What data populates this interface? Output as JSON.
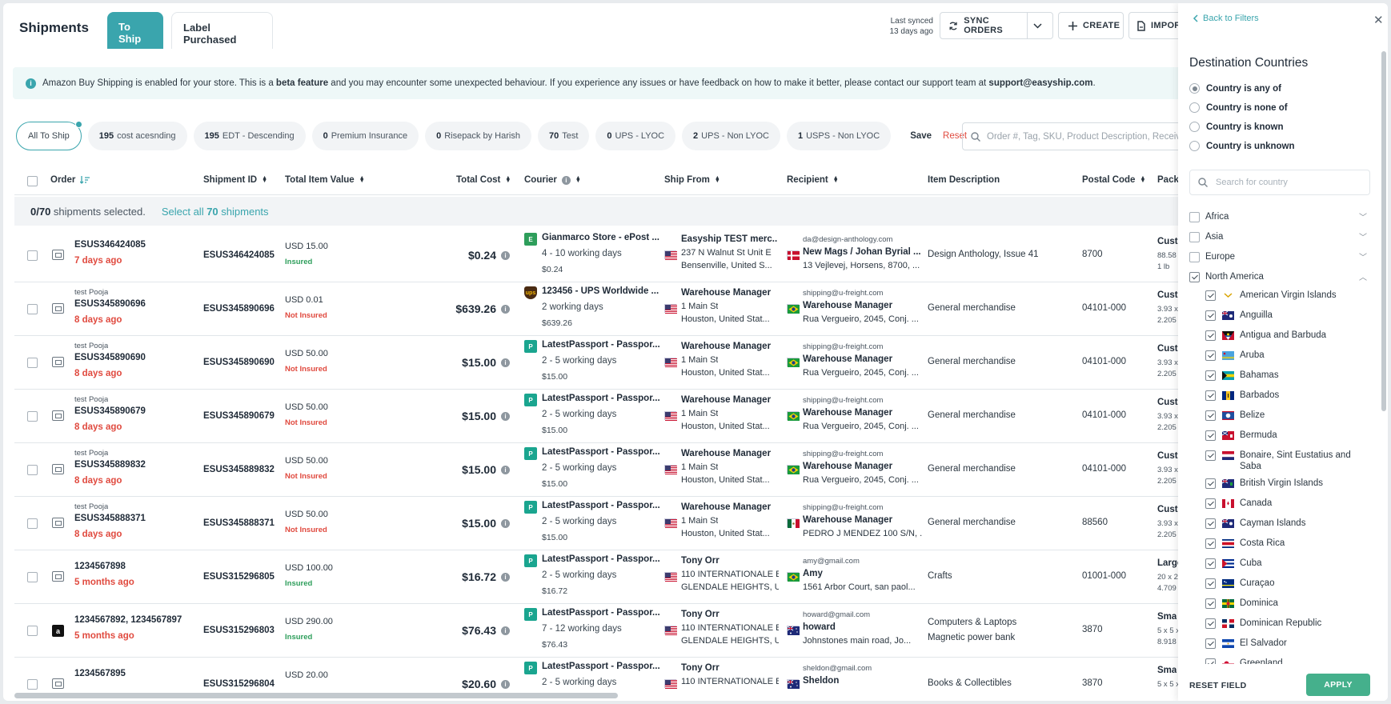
{
  "header": {
    "title": "Shipments",
    "tabs": [
      "To Ship",
      "Label Purchased"
    ],
    "last_synced_line1": "Last synced",
    "last_synced_line2": "13 days ago",
    "sync_label": "SYNC ORDERS",
    "create_label": "CREATE",
    "import_label": "IMPORT"
  },
  "banner": {
    "text_a": "Amazon Buy Shipping is enabled for your store. This is a ",
    "bold_a": "beta feature",
    "text_b": " and you may encounter some unexpected behaviour. If you experience any issues or have feedback on how to make it better, please contact our support team at ",
    "bold_b": "support@easyship.com",
    "text_c": "."
  },
  "chips": [
    {
      "count": "",
      "label": "All To Ship"
    },
    {
      "count": "195",
      "label": "cost acesnding"
    },
    {
      "count": "195",
      "label": "EDT - Descending"
    },
    {
      "count": "0",
      "label": "Premium Insurance"
    },
    {
      "count": "0",
      "label": "Risepack by Harish"
    },
    {
      "count": "70",
      "label": "Test"
    },
    {
      "count": "0",
      "label": "UPS - LYOC"
    },
    {
      "count": "2",
      "label": "UPS - Non LYOC"
    },
    {
      "count": "1",
      "label": "USPS - Non LYOC"
    }
  ],
  "chip_actions": {
    "save": "Save",
    "reset": "Reset"
  },
  "search": {
    "placeholder": "Order #, Tag, SKU, Product Description, Receiver"
  },
  "table": {
    "headers": [
      "Order",
      "Shipment ID",
      "Total Item Value",
      "Total Cost",
      "Courier",
      "Ship From",
      "Recipient",
      "Item Description",
      "Postal Code",
      "Pack"
    ],
    "selection": {
      "count": "0/70",
      "text": " shipments selected.",
      "select_all_a": "Select all ",
      "select_all_b": "70",
      "select_all_c": " shipments"
    },
    "rows": [
      {
        "tag": "",
        "order": "ESUS346424085",
        "ago": "7 days ago",
        "store": "store",
        "shipment_id": "ESUS346424085",
        "value": "USD 15.00",
        "insured": "Insured",
        "insured_color": "#2e9e5b",
        "cost": "$0.24",
        "courier_name": "Gianmarco Store - ePost ...",
        "courier_logo": "E",
        "courier_color": "#2e9e5b",
        "days": "4 - 10 working days",
        "price": "$0.24",
        "from_name": "Easyship TEST merc...",
        "from_line1": "237 N Walnut St Unit E",
        "from_line2": "Bensenville, United S...",
        "email": "da@design-anthology.com",
        "recipient": "New Mags / Johan Byrial ...",
        "raddr": "13 Vejlevej, Horsens, 8700, ...",
        "rflag": "dk",
        "desc1": "Design Anthology, Issue 41",
        "desc2": "",
        "postal": "8700",
        "pack1": "Cust",
        "pack2": "88.58",
        "pack3": "1 lb"
      },
      {
        "tag": "test Pooja",
        "order": "ESUS345890696",
        "ago": "8 days ago",
        "store": "store",
        "shipment_id": "ESUS345890696",
        "value": "USD 0.01",
        "insured": "Not Insured",
        "insured_color": "#e04a3f",
        "cost": "$639.26",
        "courier_name": "123456 - UPS Worldwide ...",
        "courier_logo": "UPS",
        "courier_color": "#4a2b12",
        "days": "2 working days",
        "price": "$639.26",
        "from_name": "Warehouse Manager",
        "from_line1": "1 Main St",
        "from_line2": "Houston, United Stat...",
        "email": "shipping@u-freight.com",
        "recipient": "Warehouse Manager",
        "raddr": "Rua Vergueiro, 2045, Conj. ...",
        "rflag": "br",
        "desc1": "General merchandise",
        "desc2": "",
        "postal": "04101-000",
        "pack1": "Cust",
        "pack2": "3.93 x",
        "pack3": "2.205"
      },
      {
        "tag": "test Pooja",
        "order": "ESUS345890690",
        "ago": "8 days ago",
        "store": "store",
        "shipment_id": "ESUS345890690",
        "value": "USD 50.00",
        "insured": "Not Insured",
        "insured_color": "#e04a3f",
        "cost": "$15.00",
        "courier_name": "LatestPassport - Passpor...",
        "courier_logo": "P",
        "courier_color": "#1aa58f",
        "days": "2 - 5 working days",
        "price": "$15.00",
        "from_name": "Warehouse Manager",
        "from_line1": "1 Main St",
        "from_line2": "Houston, United Stat...",
        "email": "shipping@u-freight.com",
        "recipient": "Warehouse Manager",
        "raddr": "Rua Vergueiro, 2045, Conj. ...",
        "rflag": "br",
        "desc1": "General merchandise",
        "desc2": "",
        "postal": "04101-000",
        "pack1": "Cust",
        "pack2": "3.93 x",
        "pack3": "2.205"
      },
      {
        "tag": "test Pooja",
        "order": "ESUS345890679",
        "ago": "8 days ago",
        "store": "store",
        "shipment_id": "ESUS345890679",
        "value": "USD 50.00",
        "insured": "Not Insured",
        "insured_color": "#e04a3f",
        "cost": "$15.00",
        "courier_name": "LatestPassport - Passpor...",
        "courier_logo": "P",
        "courier_color": "#1aa58f",
        "days": "2 - 5 working days",
        "price": "$15.00",
        "from_name": "Warehouse Manager",
        "from_line1": "1 Main St",
        "from_line2": "Houston, United Stat...",
        "email": "shipping@u-freight.com",
        "recipient": "Warehouse Manager",
        "raddr": "Rua Vergueiro, 2045, Conj. ...",
        "rflag": "br",
        "desc1": "General merchandise",
        "desc2": "",
        "postal": "04101-000",
        "pack1": "Cust",
        "pack2": "3.93 x",
        "pack3": "2.205"
      },
      {
        "tag": "test Pooja",
        "order": "ESUS345889832",
        "ago": "8 days ago",
        "store": "store",
        "shipment_id": "ESUS345889832",
        "value": "USD 50.00",
        "insured": "Not Insured",
        "insured_color": "#e04a3f",
        "cost": "$15.00",
        "courier_name": "LatestPassport - Passpor...",
        "courier_logo": "P",
        "courier_color": "#1aa58f",
        "days": "2 - 5 working days",
        "price": "$15.00",
        "from_name": "Warehouse Manager",
        "from_line1": "1 Main St",
        "from_line2": "Houston, United Stat...",
        "email": "shipping@u-freight.com",
        "recipient": "Warehouse Manager",
        "raddr": "Rua Vergueiro, 2045, Conj. ...",
        "rflag": "br",
        "desc1": "General merchandise",
        "desc2": "",
        "postal": "04101-000",
        "pack1": "Cust",
        "pack2": "3.93 x",
        "pack3": "2.205"
      },
      {
        "tag": "test Pooja",
        "order": "ESUS345888371",
        "ago": "8 days ago",
        "store": "store",
        "shipment_id": "ESUS345888371",
        "value": "USD 50.00",
        "insured": "Not Insured",
        "insured_color": "#e04a3f",
        "cost": "$15.00",
        "courier_name": "LatestPassport - Passpor...",
        "courier_logo": "P",
        "courier_color": "#1aa58f",
        "days": "2 - 5 working days",
        "price": "$15.00",
        "from_name": "Warehouse Manager",
        "from_line1": "1 Main St",
        "from_line2": "Houston, United Stat...",
        "email": "shipping@u-freight.com",
        "recipient": "Warehouse Manager",
        "raddr": "PEDRO J MENDEZ 100 S/N, ...",
        "rflag": "mx",
        "desc1": "General merchandise",
        "desc2": "",
        "postal": "88560",
        "pack1": "Cust",
        "pack2": "3.93 x",
        "pack3": "2.205"
      },
      {
        "tag": "",
        "order": "1234567898",
        "ago": "5 months ago",
        "store": "store",
        "shipment_id": "ESUS315296805",
        "value": "USD 100.00",
        "insured": "Insured",
        "insured_color": "#2e9e5b",
        "cost": "$16.72",
        "courier_name": "LatestPassport - Passpor...",
        "courier_logo": "P",
        "courier_color": "#1aa58f",
        "days": "2 - 5 working days",
        "price": "$16.72",
        "from_name": "Tony Orr",
        "from_line1": "110 INTERNATIONALE B...",
        "from_line2": "GLENDALE HEIGHTS, U...",
        "email": "amy@gmail.com",
        "recipient": "Amy",
        "raddr": "1561 Arbor Court, san paol...",
        "rflag": "br",
        "desc1": "Crafts",
        "desc2": "",
        "postal": "01001-000",
        "pack1": "Large",
        "pack2": "20 x 2",
        "pack3": "4.709"
      },
      {
        "tag": "",
        "order": "1234567892, 1234567897",
        "ago": "5 months ago",
        "store": "amazon",
        "shipment_id": "ESUS315296803",
        "value": "USD 290.00",
        "insured": "Insured",
        "insured_color": "#2e9e5b",
        "cost": "$76.43",
        "courier_name": "LatestPassport - Passpor...",
        "courier_logo": "P",
        "courier_color": "#1aa58f",
        "days": "7 - 12 working days",
        "price": "$76.43",
        "from_name": "Tony Orr",
        "from_line1": "110 INTERNATIONALE B...",
        "from_line2": "GLENDALE HEIGHTS, U...",
        "email": "howard@gmail.com",
        "recipient": "howard",
        "raddr": "Johnstones main road, Jo...",
        "rflag": "au",
        "desc1": "Computers & Laptops",
        "desc2": "Magnetic power bank",
        "postal": "3870",
        "pack1": "Sma",
        "pack2": "5 x 5 x",
        "pack3": "8.918"
      },
      {
        "tag": "",
        "order": "1234567895",
        "ago": "",
        "store": "store",
        "shipment_id": "ESUS315296804",
        "value": "USD 20.00",
        "insured": "",
        "insured_color": "#2e9e5b",
        "cost": "$20.60",
        "courier_name": "LatestPassport - Passpor...",
        "courier_logo": "P",
        "courier_color": "#1aa58f",
        "days": "2 - 5 working days",
        "price": "",
        "from_name": "Tony Orr",
        "from_line1": "110 INTERNATIONALE B...",
        "from_line2": "",
        "email": "sheldon@gmail.com",
        "recipient": "Sheldon",
        "raddr": "",
        "rflag": "au",
        "desc1": "Books & Collectibles",
        "desc2": "",
        "postal": "3870",
        "pack1": "Sma",
        "pack2": "5 x 5 x",
        "pack3": ""
      }
    ]
  },
  "panel": {
    "back": "Back to Filters",
    "title": "Destination Countries",
    "options": [
      "Country is any of",
      "Country is none of",
      "Country is known",
      "Country is unknown"
    ],
    "search_placeholder": "Search for country",
    "regions": [
      {
        "name": "Africa",
        "checked": false,
        "expanded": false
      },
      {
        "name": "Asia",
        "checked": false,
        "expanded": false
      },
      {
        "name": "Europe",
        "checked": false,
        "expanded": false
      },
      {
        "name": "North America",
        "checked": true,
        "expanded": true
      }
    ],
    "countries": [
      "American Virgin Islands",
      "Anguilla",
      "Antigua and Barbuda",
      "Aruba",
      "Bahamas",
      "Barbados",
      "Belize",
      "Bermuda",
      "Bonaire, Sint Eustatius and Saba",
      "British Virgin Islands",
      "Canada",
      "Cayman Islands",
      "Costa Rica",
      "Cuba",
      "Curaçao",
      "Dominica",
      "Dominican Republic",
      "El Salvador",
      "Greenland"
    ],
    "reset": "RESET FIELD",
    "apply": "APPLY"
  }
}
